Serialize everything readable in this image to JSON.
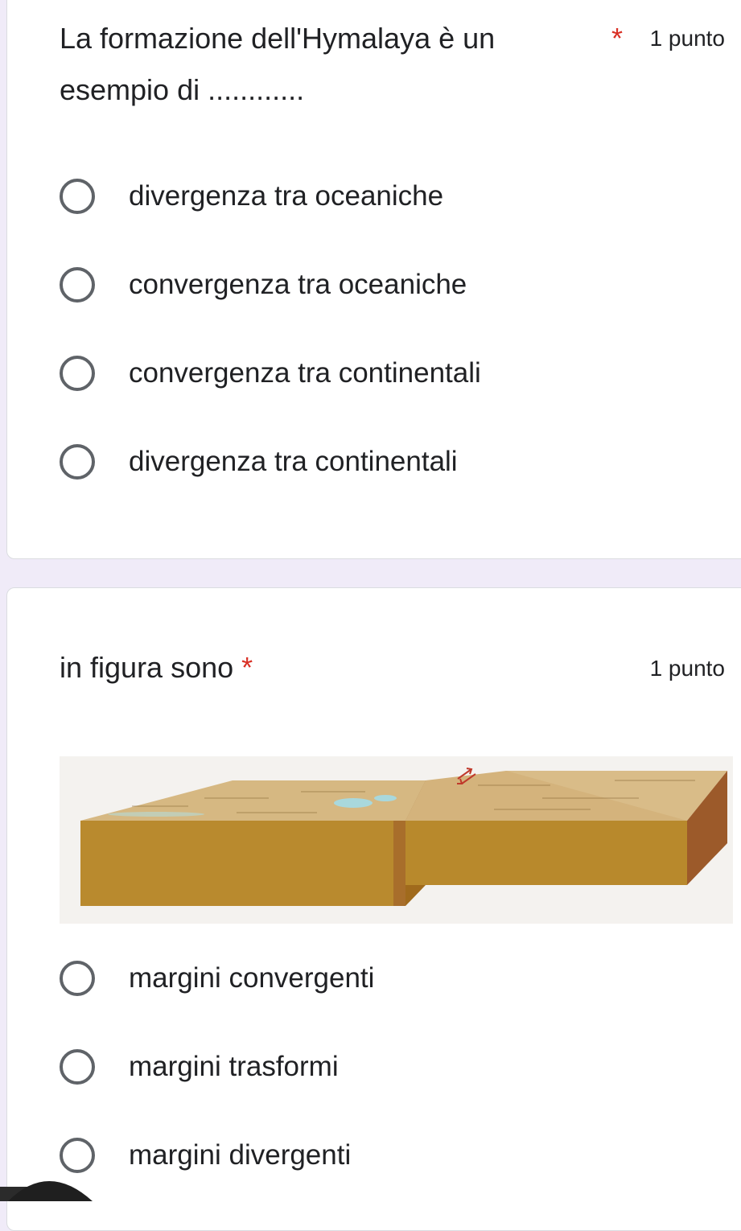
{
  "question1": {
    "title_line1": "La formazione dell'Hymalaya è un",
    "title_line2": "esempio di ............",
    "required_star": "*",
    "points": "1 punto",
    "options": [
      "divergenza tra oceaniche",
      "convergenza tra oceaniche",
      "convergenza tra continentali",
      "divergenza tra continentali"
    ]
  },
  "question2": {
    "title": "in figura sono",
    "required_star": "*",
    "points": "1 punto",
    "figure_icon": "transform-fault-block-diagram",
    "options": [
      "margini convergenti",
      "margini trasformi",
      "margini divergenti"
    ]
  },
  "colors": {
    "background": "#f0ebf8",
    "card": "#ffffff",
    "required": "#d93025",
    "radio_border": "#5f6368",
    "rock_side": "#b8862a",
    "rock_top": "#d2b27a"
  }
}
